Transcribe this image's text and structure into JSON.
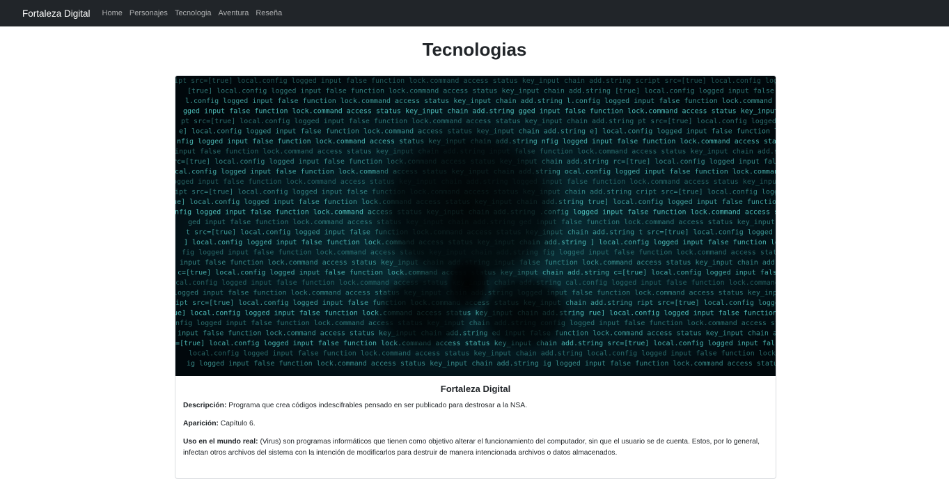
{
  "navbar": {
    "brand": "Fortaleza Digital",
    "links": [
      "Home",
      "Personajes",
      "Tecnologia",
      "Aventura",
      "Reseña"
    ]
  },
  "page": {
    "title": "Tecnologias"
  },
  "card": {
    "image_alt": "Fortaleza Digital",
    "title": "Fortaleza Digital",
    "descripcion_label": "Descripción:",
    "descripcion": "Programa que crea códigos indescifrables pensado en ser publicado para destrosar a la NSA.",
    "aparicion_label": "Aparición:",
    "aparicion": "Capítulo 6.",
    "uso_label": "Uso en el mundo real:",
    "uso": "(Virus) son programas informáticos que tienen como objetivo alterar el funcionamiento del computador, sin que el usuario se de cuenta. Estos, por lo general, infectan otros archivos del sistema con la intención de modificarlos para destruir de manera intencionada archivos o datos almacenados."
  },
  "colors": {
    "navbar_bg": "#212529",
    "code_text": "#5fe6e0",
    "image_bg": "#01080c"
  },
  "icons": {
    "card_image": "hacker-skull-code-image"
  }
}
